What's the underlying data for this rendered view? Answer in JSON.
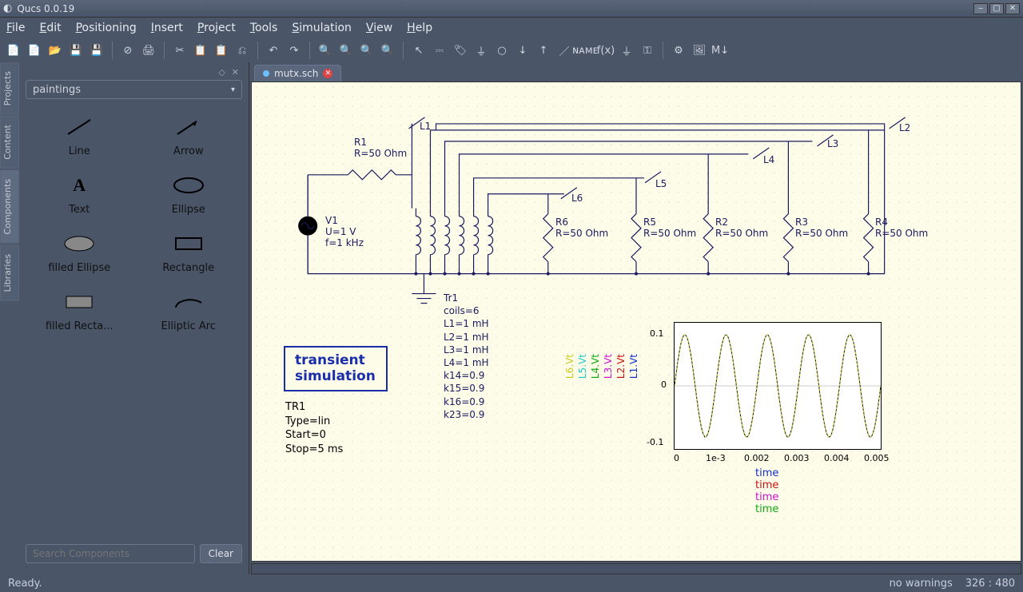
{
  "window": {
    "title": "Qucs 0.0.19"
  },
  "menu": [
    "File",
    "Edit",
    "Positioning",
    "Insert",
    "Project",
    "Tools",
    "Simulation",
    "View",
    "Help"
  ],
  "toolbar_icons": [
    "new",
    "new2",
    "open",
    "save",
    "saveall",
    "",
    "delete",
    "print",
    "",
    "cut",
    "copy",
    "paste",
    "undo",
    "",
    "back",
    "forward",
    "",
    "zoomout",
    "zoomin",
    "zoomfit",
    "zoomsel",
    "",
    "pointer",
    "wire",
    "label",
    "ground",
    "port",
    "arrowdn",
    "arrowup",
    "line",
    "name",
    "eqn",
    "gnd2",
    "key",
    "",
    "gear",
    "img",
    "m1"
  ],
  "dock": {
    "tabs": [
      "Projects",
      "Content",
      "Components",
      "Libraries"
    ],
    "active_tab": 2,
    "combo": "paintings",
    "palette": [
      {
        "key": "line",
        "label": "Line"
      },
      {
        "key": "arrow",
        "label": "Arrow"
      },
      {
        "key": "text",
        "label": "Text"
      },
      {
        "key": "ellipse",
        "label": "Ellipse"
      },
      {
        "key": "fellipse",
        "label": "filled Ellipse"
      },
      {
        "key": "rect",
        "label": "Rectangle"
      },
      {
        "key": "frect",
        "label": "filled Recta..."
      },
      {
        "key": "earc",
        "label": "Elliptic Arc"
      }
    ],
    "search_placeholder": "Search Components",
    "clear_label": "Clear"
  },
  "document": {
    "tab_name": "mutx.sch"
  },
  "schematic": {
    "R1": {
      "name": "R1",
      "value": "R=50 Ohm"
    },
    "V1": {
      "name": "V1",
      "p1": "U=1 V",
      "p2": "f=1 kHz"
    },
    "probes": [
      "L1",
      "L2",
      "L3",
      "L4",
      "L5",
      "L6"
    ],
    "loads": [
      {
        "name": "R6",
        "val": "R=50 Ohm"
      },
      {
        "name": "R5",
        "val": "R=50 Ohm"
      },
      {
        "name": "R2",
        "val": "R=50 Ohm"
      },
      {
        "name": "R3",
        "val": "R=50 Ohm"
      },
      {
        "name": "R4",
        "val": "R=50 Ohm"
      }
    ],
    "Tr1": {
      "name": "Tr1",
      "lines": [
        "coils=6",
        "L1=1 mH",
        "L2=1 mH",
        "L3=1 mH",
        "L4=1 mH",
        "k14=0.9",
        "k15=0.9",
        "k16=0.9",
        "k23=0.9"
      ]
    },
    "transient": {
      "title1": "transient",
      "title2": "simulation",
      "params": [
        "TR1",
        "Type=lin",
        "Start=0",
        "Stop=5 ms"
      ]
    }
  },
  "plot": {
    "yticks": [
      "0.1",
      "0",
      "-0.1"
    ],
    "xticks": [
      "0",
      "1e-3",
      "0.002",
      "0.003",
      "0.004",
      "0.005"
    ],
    "xlabel": "time",
    "xlabels": [
      {
        "text": "time",
        "color": "#1030cc"
      },
      {
        "text": "time",
        "color": "#cc1010"
      },
      {
        "text": "time",
        "color": "#cc10cc"
      },
      {
        "text": "time",
        "color": "#10aa10"
      }
    ],
    "legend": [
      {
        "t": "L6.Vt",
        "c": "#cccc20"
      },
      {
        "t": "L5.Vt",
        "c": "#20cccc"
      },
      {
        "t": "L4.Vt",
        "c": "#10aa10"
      },
      {
        "t": "L3.Vt",
        "c": "#cc10cc"
      },
      {
        "t": "L2.Vt",
        "c": "#cc1010"
      },
      {
        "t": "L1.Vt",
        "c": "#1030cc"
      }
    ]
  },
  "chart_data": {
    "type": "line",
    "title": "",
    "xlabel": "time",
    "ylabel": "",
    "xlim": [
      0,
      0.005
    ],
    "ylim": [
      -0.12,
      0.12
    ],
    "yticks": [
      -0.1,
      0,
      0.1
    ],
    "xticks": [
      0,
      0.001,
      0.002,
      0.003,
      0.004,
      0.005
    ],
    "series": [
      {
        "name": "L1.Vt",
        "color": "#1030cc",
        "amplitude": 0.1,
        "freq_hz": 1000,
        "phase_deg": 0
      },
      {
        "name": "L2.Vt",
        "color": "#cc1010",
        "amplitude": 0.1,
        "freq_hz": 1000,
        "phase_deg": 0
      },
      {
        "name": "L3.Vt",
        "color": "#cc10cc",
        "amplitude": 0.1,
        "freq_hz": 1000,
        "phase_deg": 0
      },
      {
        "name": "L4.Vt",
        "color": "#10aa10",
        "amplitude": 0.1,
        "freq_hz": 1000,
        "phase_deg": 0
      },
      {
        "name": "L5.Vt",
        "color": "#20cccc",
        "amplitude": 0.1,
        "freq_hz": 1000,
        "phase_deg": 0
      },
      {
        "name": "L6.Vt",
        "color": "#cccc20",
        "amplitude": 0.1,
        "freq_hz": 1000,
        "phase_deg": 0
      }
    ],
    "note": "All six traces overlap; curve is sinusoidal 1 kHz, amplitude ≈0.10, over 0–5 ms (5 periods)."
  },
  "status": {
    "left": "Ready.",
    "warn": "no warnings",
    "coords": "326 : 480"
  }
}
